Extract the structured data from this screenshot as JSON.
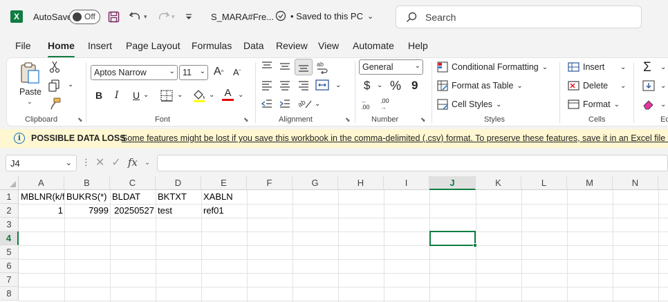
{
  "titlebar": {
    "autosave_label": "AutoSave",
    "toggle_state": "Off",
    "filename": "S_MARA#Fre...",
    "saved_status": "• Saved to this PC",
    "search_placeholder": "Search",
    "logo_letter": "X"
  },
  "tabs": [
    "File",
    "Home",
    "Insert",
    "Page Layout",
    "Formulas",
    "Data",
    "Review",
    "View",
    "Automate",
    "Help"
  ],
  "active_tab": "Home",
  "ribbon": {
    "clipboard": {
      "paste_label": "Paste",
      "group_label": "Clipboard"
    },
    "font": {
      "font_name": "Aptos Narrow",
      "font_size": "11",
      "bold": "B",
      "italic": "I",
      "underline": "U",
      "font_color_glyph": "A",
      "grow_glyph": "A",
      "shrink_glyph": "A",
      "group_label": "Font"
    },
    "alignment": {
      "group_label": "Alignment"
    },
    "number": {
      "format": "General",
      "currency": "$",
      "percent": "%",
      "comma": "9",
      "inc_decimal": ".00",
      "dec_decimal": ".00",
      "group_label": "Number"
    },
    "styles": {
      "conditional_formatting": "Conditional Formatting",
      "format_as_table": "Format as Table",
      "cell_styles": "Cell Styles",
      "group_label": "Styles"
    },
    "cells": {
      "insert": "Insert",
      "delete": "Delete",
      "format": "Format",
      "group_label": "Cells"
    },
    "editing": {
      "group_label_partial": "Ed"
    }
  },
  "infobar": {
    "title": "POSSIBLE DATA LOSS",
    "message": "Some features might be lost if you save this workbook in the comma-delimited (.csv) format. To preserve these features, save it in an Excel file for"
  },
  "formula_bar": {
    "name_box": "J4",
    "fx_label": "fx",
    "value": ""
  },
  "sheet": {
    "columns": [
      "A",
      "B",
      "C",
      "D",
      "E",
      "F",
      "G",
      "H",
      "I",
      "J",
      "K",
      "L",
      "M",
      "N"
    ],
    "rows": [
      "1",
      "2",
      "3",
      "4",
      "5",
      "6",
      "7",
      "8"
    ],
    "selected_column": "J",
    "selected_row": "4",
    "cells": {
      "A1": "MBLNR(k/f)",
      "B1": "BUKRS(*)",
      "C1": "BLDAT",
      "D1": "BKTXT",
      "E1": "XABLN",
      "A2": "1",
      "B2": "7999",
      "C2": "20250527",
      "D2": "test",
      "E2": "ref01"
    }
  },
  "colors": {
    "accent": "#107c41",
    "infobar_bg": "#fff7d1",
    "link_blue": "#0f6cbd"
  }
}
